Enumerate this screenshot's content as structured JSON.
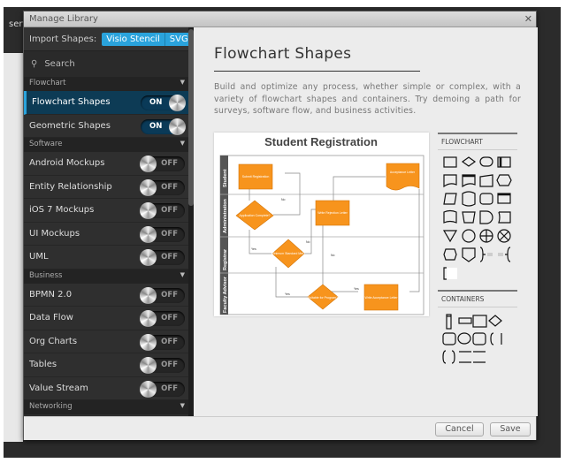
{
  "app": {
    "tab_fragment": "sert"
  },
  "dialog": {
    "title": "Manage Library"
  },
  "sidebar": {
    "import_label": "Import Shapes:",
    "import_buttons": [
      "Visio Stencil",
      "SVG"
    ],
    "search_placeholder": "Search",
    "sections": [
      {
        "title": "Flowchart",
        "items": [
          {
            "label": "Flowchart Shapes",
            "state": "ON",
            "selected": true
          },
          {
            "label": "Geometric Shapes",
            "state": "ON"
          }
        ]
      },
      {
        "title": "Software",
        "items": [
          {
            "label": "Android Mockups",
            "state": "OFF"
          },
          {
            "label": "Entity Relationship",
            "state": "OFF"
          },
          {
            "label": "iOS 7 Mockups",
            "state": "OFF"
          },
          {
            "label": "UI Mockups",
            "state": "OFF"
          },
          {
            "label": "UML",
            "state": "OFF"
          }
        ]
      },
      {
        "title": "Business",
        "items": [
          {
            "label": "BPMN 2.0",
            "state": "OFF"
          },
          {
            "label": "Data Flow",
            "state": "OFF"
          },
          {
            "label": "Org Charts",
            "state": "OFF"
          },
          {
            "label": "Tables",
            "state": "OFF"
          },
          {
            "label": "Value Stream",
            "state": "OFF"
          }
        ]
      },
      {
        "title": "Networking",
        "items": []
      }
    ]
  },
  "content": {
    "title": "Flowchart Shapes",
    "description": "Build and optimize any process, whether simple or complex, with a variety of flowchart shapes and containers. Try demoing a path for surveys, software flow, and business activities.",
    "preview": {
      "title": "Student Registration",
      "lanes": [
        "Student",
        "Administration",
        "Registrar",
        "Faculty Advisor"
      ],
      "nodes": [
        "Submit Registration",
        "Application Complete?",
        "Minimum Standard Met?",
        "Write Rejection Letter",
        "Suitable for Program?",
        "Write Acceptance Letter",
        "Acceptance Letter"
      ],
      "edge_labels": [
        "No",
        "Yes",
        "No",
        "No",
        "Yes",
        "Yes"
      ],
      "accent": "#f7941d"
    },
    "palette": {
      "flowchart_heading": "FLOWCHART",
      "containers_heading": "CONTAINERS"
    }
  },
  "footer": {
    "cancel": "Cancel",
    "save": "Save"
  },
  "colors": {
    "accent": "#2aa3dc",
    "selected_row": "#0d3b55"
  }
}
